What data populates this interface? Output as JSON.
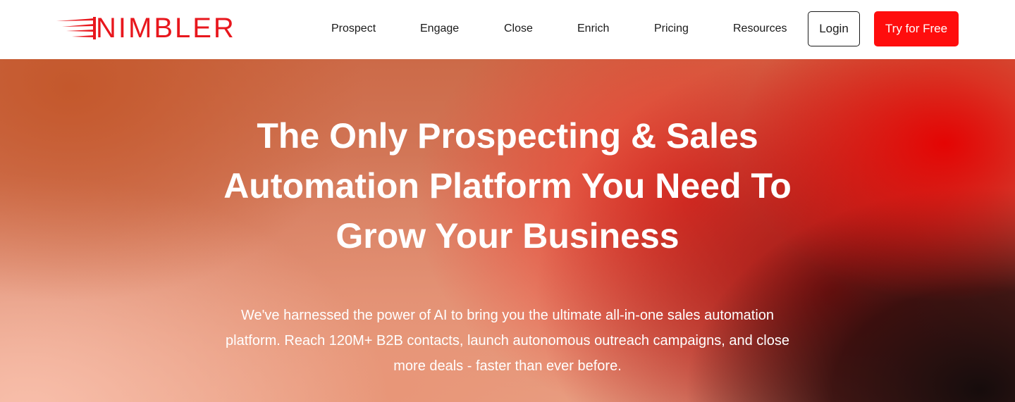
{
  "brand": {
    "name": "NIMBLER",
    "accent_color": "#e8171d"
  },
  "nav": {
    "links": [
      {
        "label": "Prospect"
      },
      {
        "label": "Engage"
      },
      {
        "label": "Close"
      },
      {
        "label": "Enrich"
      },
      {
        "label": "Pricing"
      },
      {
        "label": "Resources"
      }
    ],
    "login_label": "Login",
    "cta_label": "Try for Free",
    "cta_color": "#ff0d0d"
  },
  "hero": {
    "title": "The Only Prospecting & Sales Automation Platform You Need To Grow Your Business",
    "subtitle": "We've harnessed the power of AI to bring you the ultimate all-in-one sales automation platform. Reach 120M+ B2B contacts, launch autonomous outreach campaigns, and close more deals - faster than ever before."
  }
}
